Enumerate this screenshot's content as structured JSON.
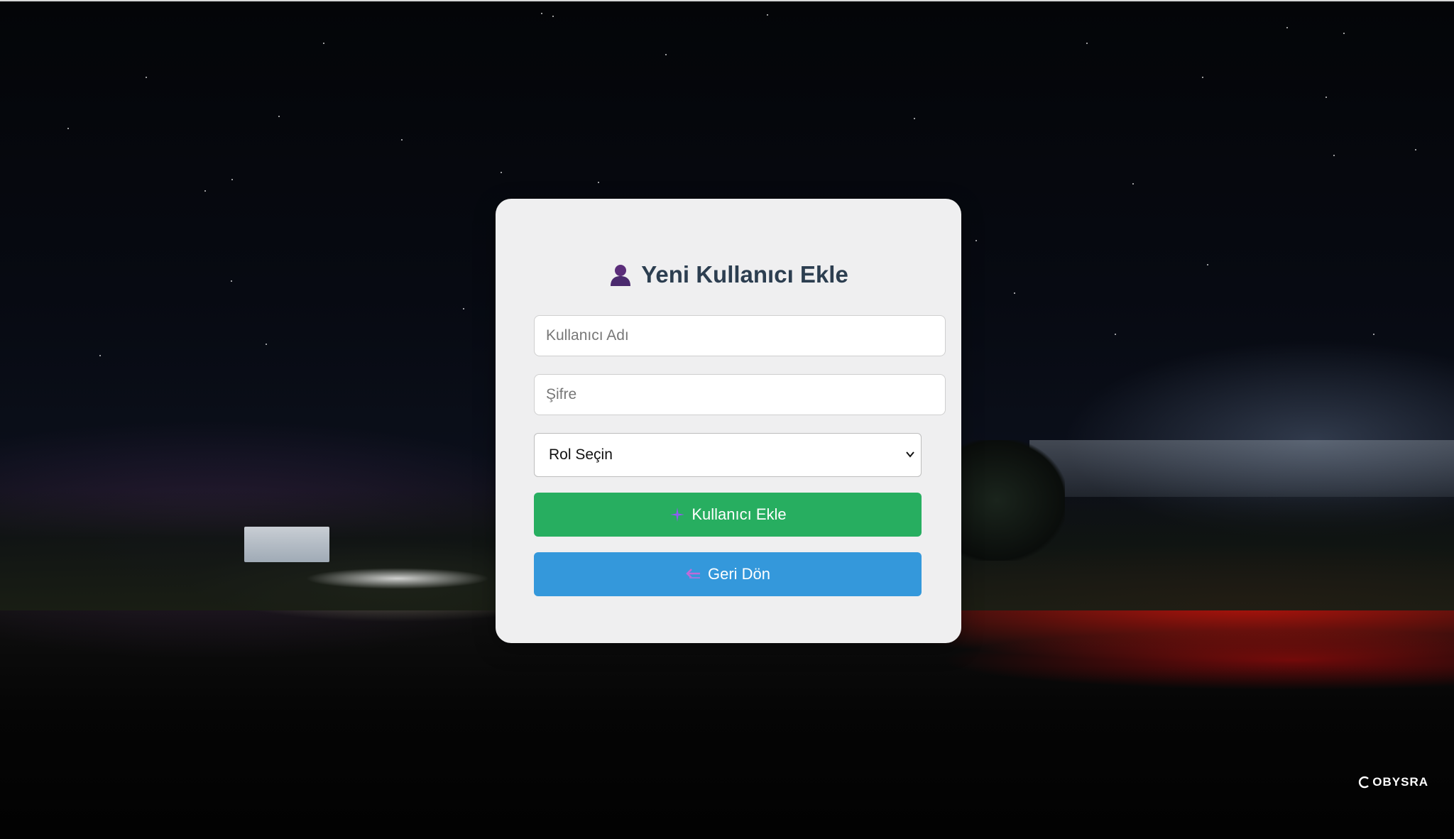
{
  "form": {
    "title": "Yeni Kullanıcı Ekle",
    "username_placeholder": "Kullanıcı Adı",
    "password_placeholder": "Şifre",
    "role_select_value": "Rol Seçin",
    "add_button_label": "Kullanıcı Ekle",
    "back_button_label": "Geri Dön"
  },
  "brand": {
    "name": "OBYSRA"
  },
  "icons": {
    "title_icon": "user-icon",
    "add_icon": "plus-icon",
    "back_icon": "back-arrow-icon",
    "chevron": "chevron-down-icon"
  },
  "colors": {
    "add_button": "#27ae60",
    "back_button": "#3498db",
    "title_text": "#2c3e50",
    "user_icon": "#5b2d7a"
  }
}
